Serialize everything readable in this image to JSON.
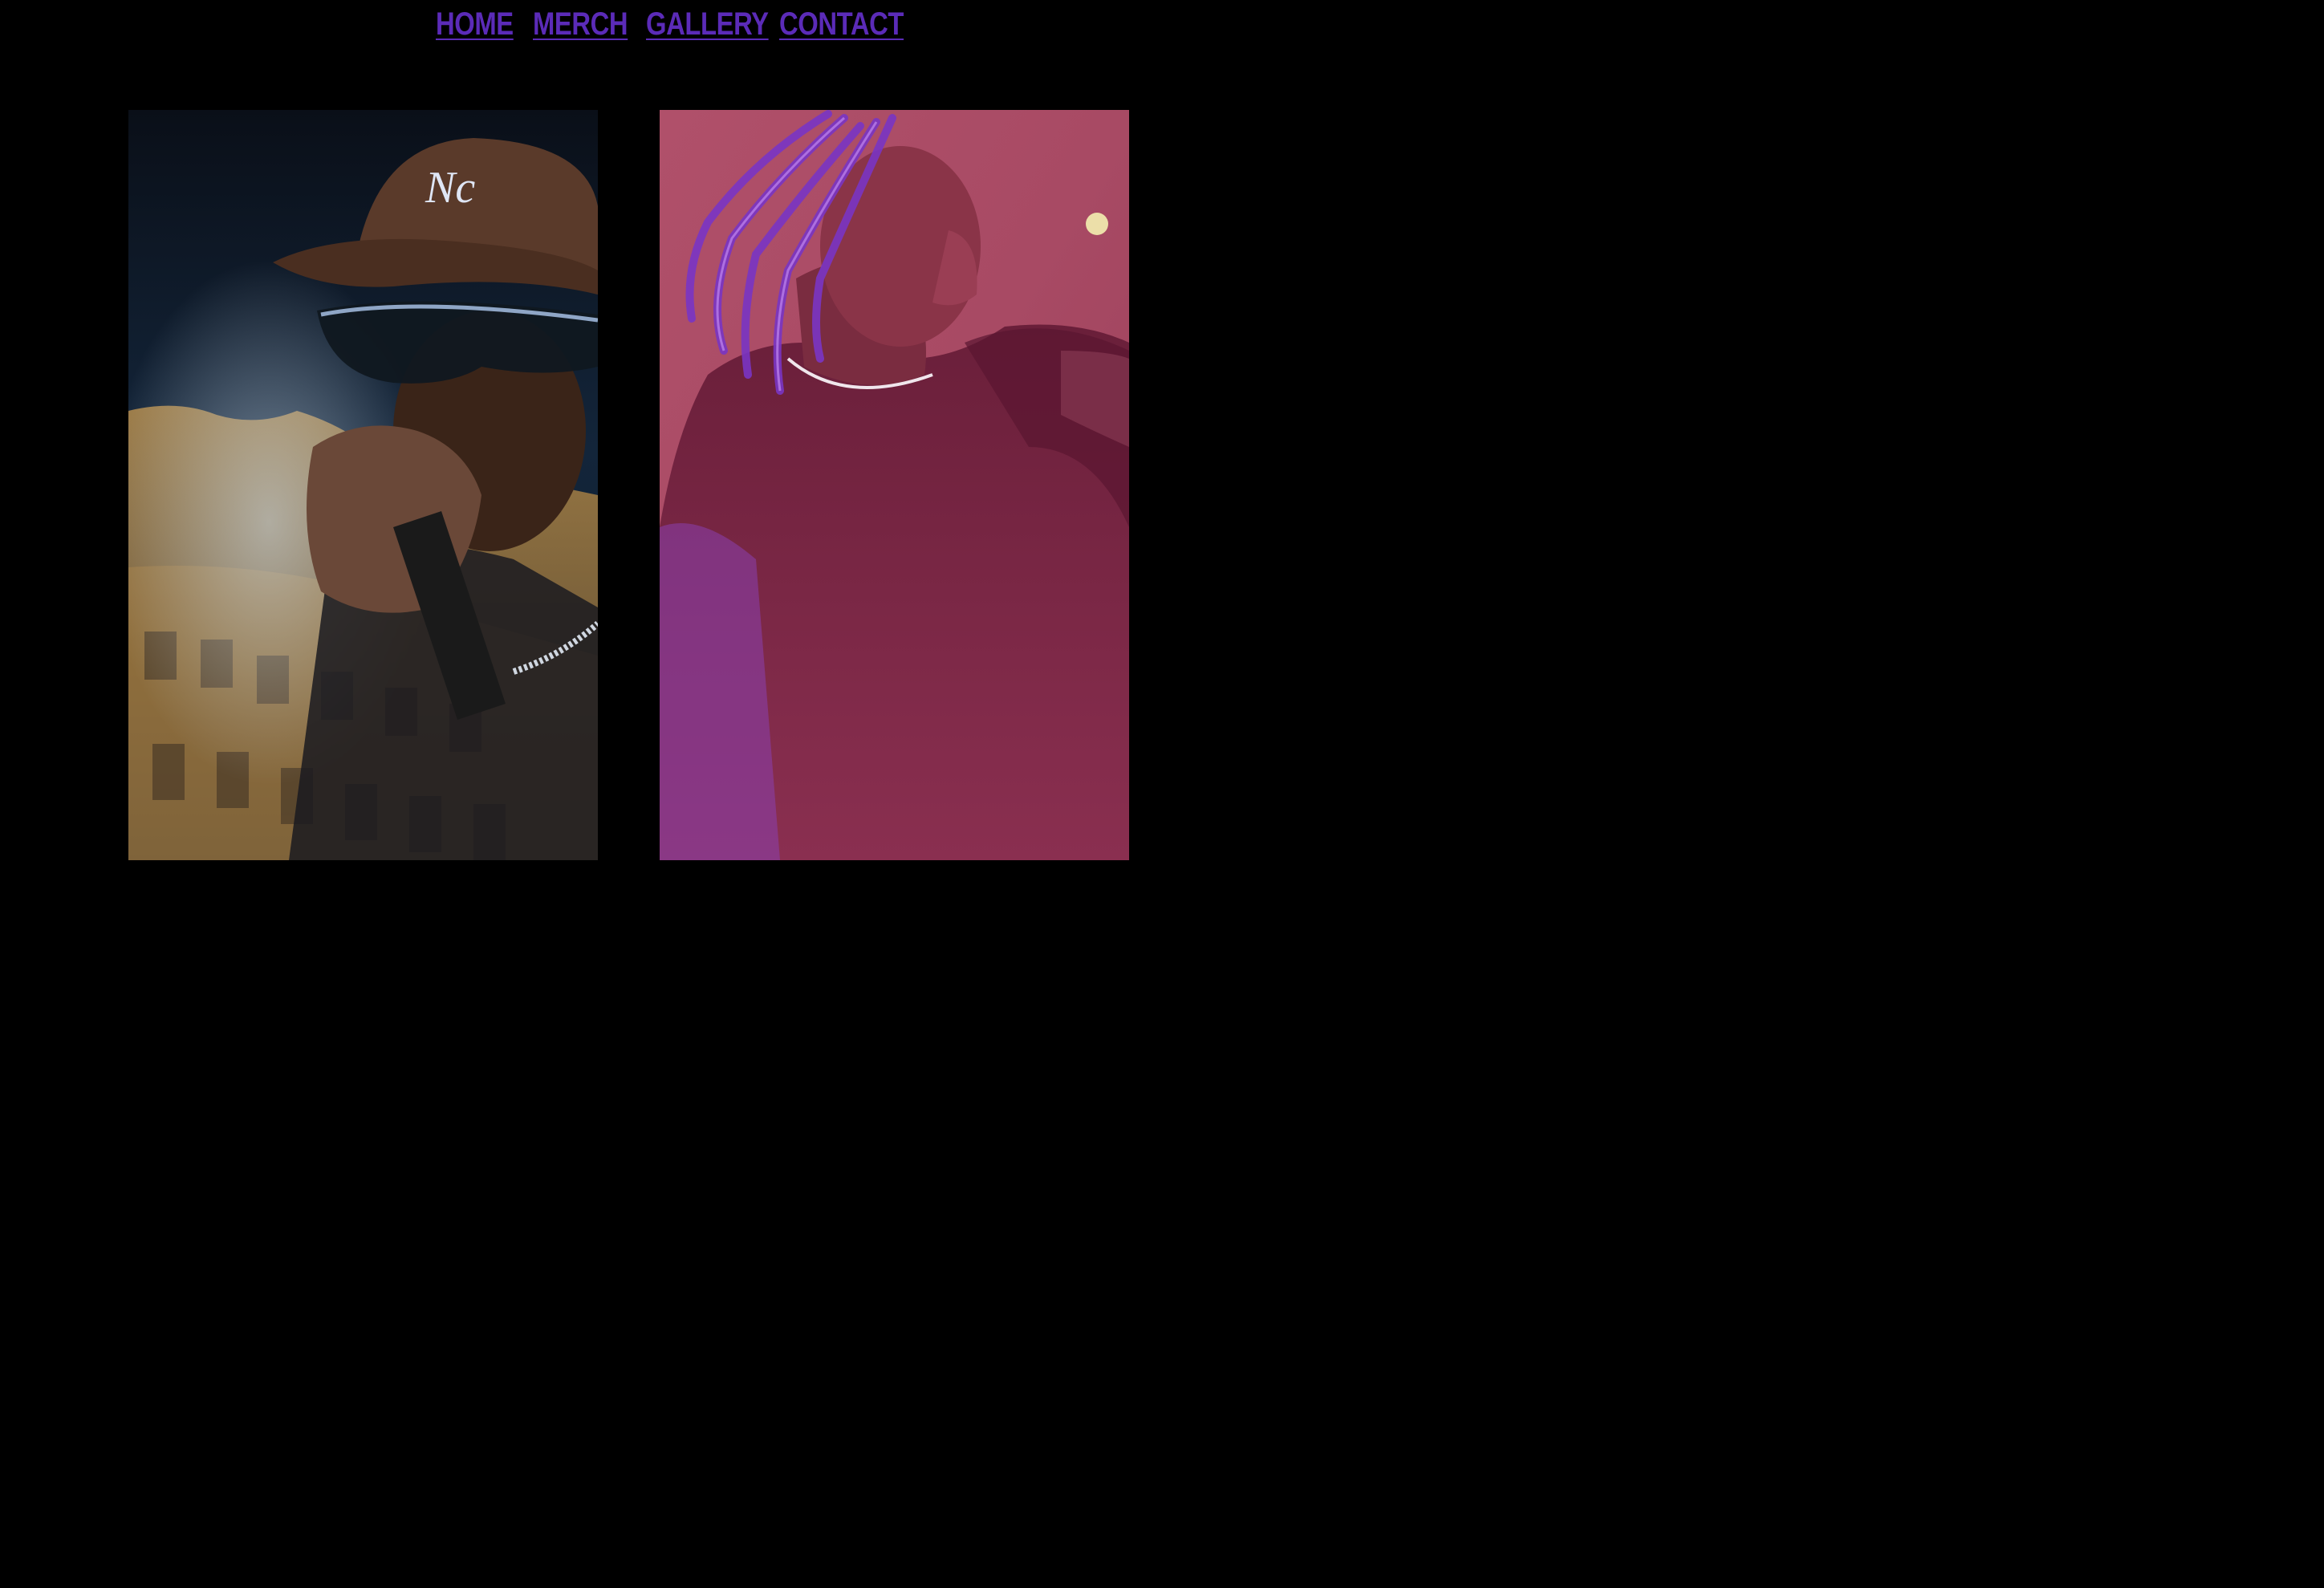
{
  "nav": {
    "items": [
      {
        "label": "Home"
      },
      {
        "label": "Merch"
      },
      {
        "label": "Gallery"
      },
      {
        "label": "Contact"
      }
    ],
    "link_color": "#5b2bb8"
  },
  "gallery": {
    "photos": [
      {
        "subject": "performer in brown cap and sunglasses holding microphone, city building overlay"
      },
      {
        "subject": "performer with braided hair in dark shirt, purple-pink stage lighting"
      }
    ]
  },
  "colors": {
    "background": "#000000",
    "accent": "#5b2bb8"
  }
}
